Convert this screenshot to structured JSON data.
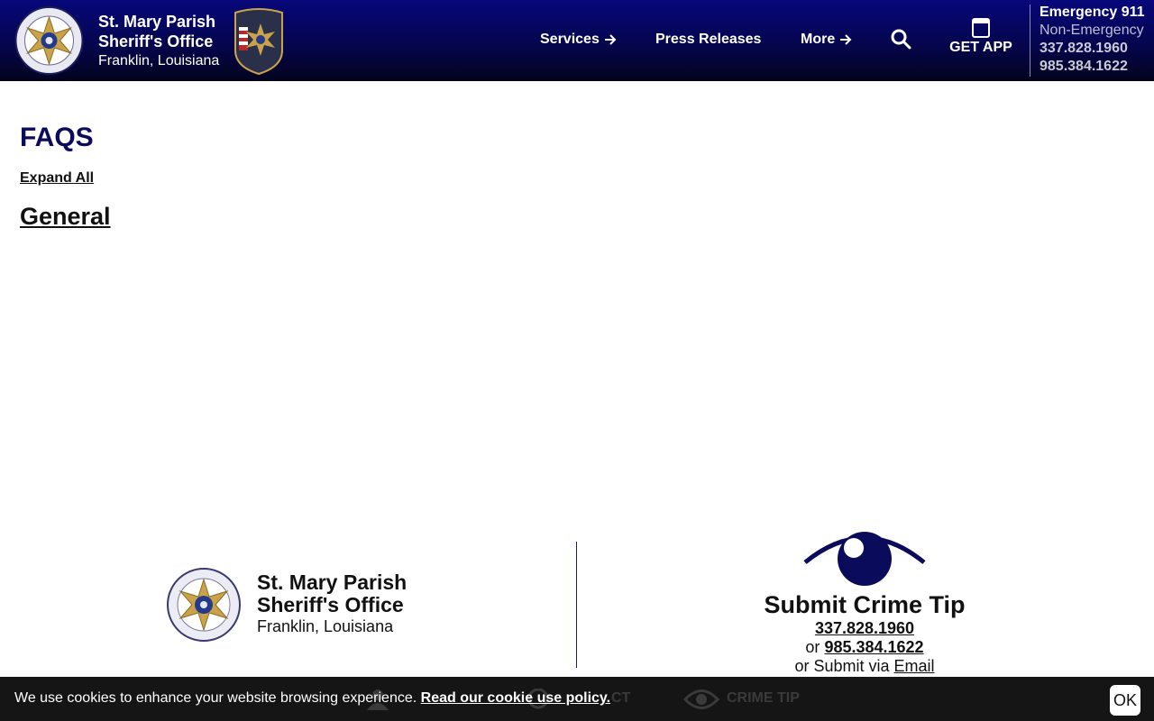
{
  "header": {
    "brand_line1": "St. Mary Parish",
    "brand_line2": "Sheriff's Office",
    "brand_line3": "Franklin, Louisiana",
    "nav": {
      "services": "Services",
      "press_releases": "Press Releases",
      "more": "More"
    },
    "get_app": "GET APP",
    "emergency": "Emergency 911",
    "non_emergency": "Non-Emergency",
    "phone1": "337.828.1960",
    "phone2": "985.384.1622",
    "colors": {
      "header_bg": "#05054e",
      "accent": "#0b0b5c"
    }
  },
  "main": {
    "title": "FAQS",
    "expand_all": "Expand All",
    "section": "General"
  },
  "footer": {
    "brand_line1": "St. Mary Parish",
    "brand_line2": "Sheriff's Office",
    "brand_line3": "Franklin, Louisiana",
    "tip_title": "Submit Crime Tip",
    "tip_phone1": "337.828.1960",
    "tip_or": "or",
    "tip_phone2": "985.384.1622",
    "tip_submit_via": "or Submit via",
    "tip_email": "Email"
  },
  "cookie_bar": {
    "text": "We use cookies to enhance your website browsing experience.",
    "link": "Read our cookie use policy.",
    "ok": "OK",
    "behind_contact": "CT",
    "behind_crime_tip": "CRIME TIP"
  }
}
